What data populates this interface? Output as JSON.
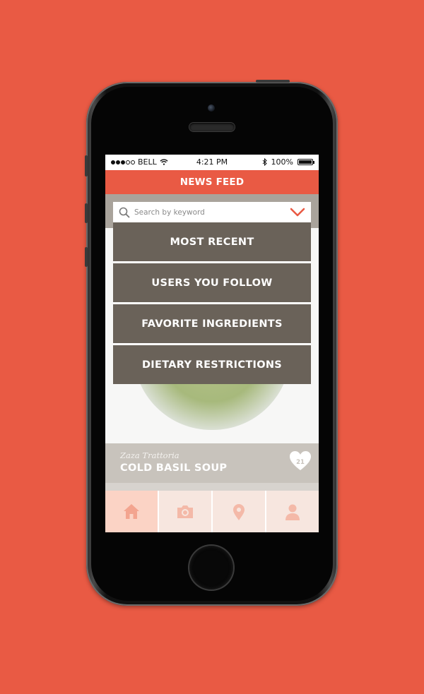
{
  "colors": {
    "background": "#E95A44",
    "accent": "#E95A44",
    "menu_bg": "#6a6259",
    "post_bar": "#c8c3bc",
    "tab_bg": "#f7e6df",
    "tab_active": "#fbd3c5"
  },
  "status_bar": {
    "carrier": "BELL",
    "time": "4:21 PM",
    "battery": "100%",
    "signal_bars_filled": 3,
    "signal_bars_total": 5
  },
  "header": {
    "title": "NEWS FEED"
  },
  "search": {
    "placeholder": "Search by keyword",
    "icon": "search-icon",
    "dropdown_icon": "chevron-down-icon"
  },
  "filter_menu": {
    "items": [
      {
        "label": "MOST RECENT"
      },
      {
        "label": "USERS YOU FOLLOW"
      },
      {
        "label": "FAVORITE INGREDIENTS"
      },
      {
        "label": "DIETARY RESTRICTIONS"
      }
    ]
  },
  "post": {
    "restaurant": "Zaza Trattoria",
    "dish": "COLD BASIL SOUP",
    "likes": "21",
    "like_icon": "heart-icon"
  },
  "tab_bar": {
    "tabs": [
      {
        "icon": "home-icon",
        "active": true
      },
      {
        "icon": "camera-icon",
        "active": false
      },
      {
        "icon": "location-pin-icon",
        "active": false
      },
      {
        "icon": "user-icon",
        "active": false
      }
    ]
  }
}
